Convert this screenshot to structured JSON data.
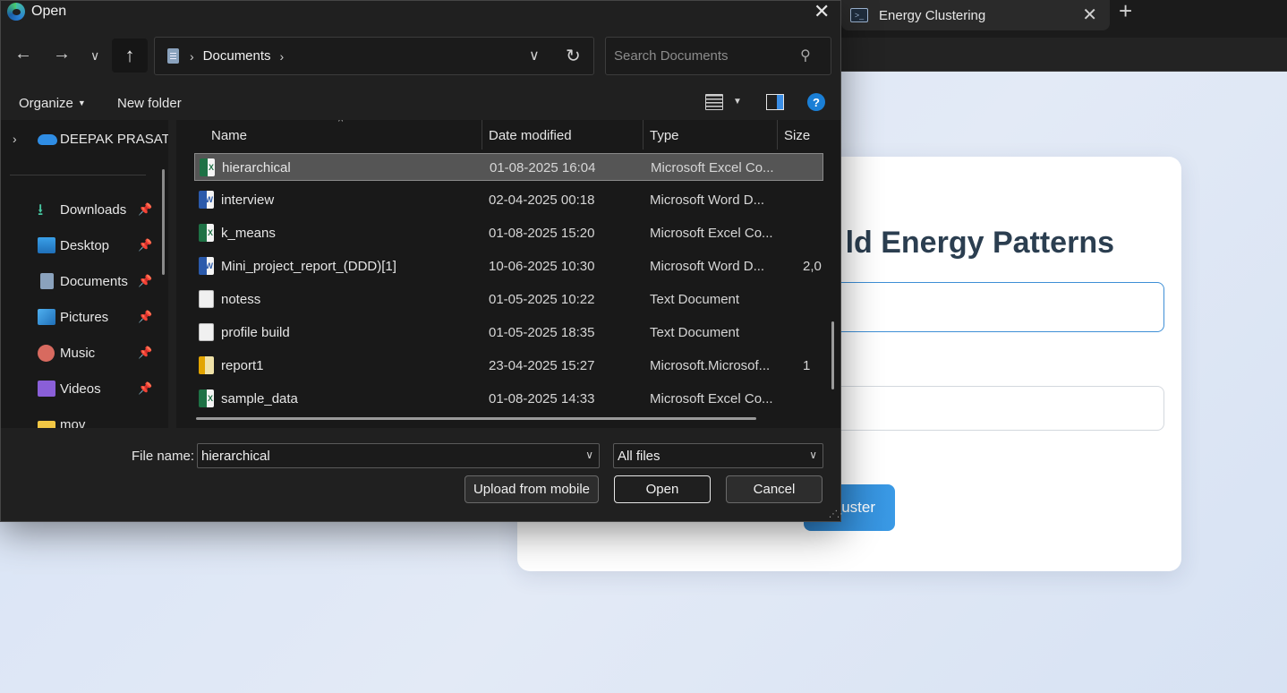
{
  "browser": {
    "tab_title": "Energy Clustering",
    "tab_close": "✕",
    "new_tab": "+"
  },
  "page": {
    "title_visible": "ld Energy Patterns",
    "button_label_visible": "uster"
  },
  "dialog": {
    "title": "Open",
    "close": "✕",
    "address": {
      "location": "Documents",
      "separator": "›"
    },
    "search": {
      "placeholder": "Search Documents"
    },
    "commands": {
      "organize": "Organize",
      "new_folder": "New folder",
      "help": "?"
    },
    "nav": {
      "onedrive": "DEEPAK PRASAT",
      "items": [
        {
          "label": "Downloads",
          "icon": "download-icon",
          "pinned": true
        },
        {
          "label": "Desktop",
          "icon": "desktop-icon",
          "pinned": true
        },
        {
          "label": "Documents",
          "icon": "documents-icon",
          "pinned": true
        },
        {
          "label": "Pictures",
          "icon": "pictures-icon",
          "pinned": true
        },
        {
          "label": "Music",
          "icon": "music-icon",
          "pinned": true
        },
        {
          "label": "Videos",
          "icon": "videos-icon",
          "pinned": true
        },
        {
          "label": "mov",
          "icon": "folder-icon",
          "pinned": false
        }
      ]
    },
    "columns": {
      "name": "Name",
      "date": "Date modified",
      "type": "Type",
      "size": "Size"
    },
    "files": [
      {
        "name": "hierarchical",
        "date": "01-08-2025 16:04",
        "type": "Microsoft Excel Co...",
        "size": "",
        "icon": "excel-file-icon",
        "selected": true
      },
      {
        "name": "interview",
        "date": "02-04-2025 00:18",
        "type": "Microsoft Word D...",
        "size": "",
        "icon": "word-file-icon",
        "selected": false
      },
      {
        "name": "k_means",
        "date": "01-08-2025 15:20",
        "type": "Microsoft Excel Co...",
        "size": "",
        "icon": "excel-file-icon",
        "selected": false
      },
      {
        "name": "Mini_project_report_(DDD)[1]",
        "date": "10-06-2025 10:30",
        "type": "Microsoft Word D...",
        "size": "2,0",
        "icon": "word-file-icon",
        "selected": false
      },
      {
        "name": "notess",
        "date": "01-05-2025 10:22",
        "type": "Text Document",
        "size": "",
        "icon": "text-file-icon",
        "selected": false
      },
      {
        "name": "profile build",
        "date": "01-05-2025 18:35",
        "type": "Text Document",
        "size": "",
        "icon": "text-file-icon",
        "selected": false
      },
      {
        "name": "report1",
        "date": "23-04-2025 15:27",
        "type": "Microsoft.Microsof...",
        "size": "1",
        "icon": "publisher-file-icon",
        "selected": false
      },
      {
        "name": "sample_data",
        "date": "01-08-2025 14:33",
        "type": "Microsoft Excel Co...",
        "size": "",
        "icon": "excel-file-icon",
        "selected": false
      }
    ],
    "footer": {
      "file_name_label": "File name:",
      "file_name_value": "hierarchical",
      "file_type": "All files",
      "upload_button": "Upload from mobile",
      "open_button": "Open",
      "cancel_button": "Cancel"
    }
  },
  "colors": {
    "dialog_bg": "#202020",
    "selected_row": "#555555",
    "accent": "#1a7fd6",
    "page_bg": "#dbe4f3"
  }
}
